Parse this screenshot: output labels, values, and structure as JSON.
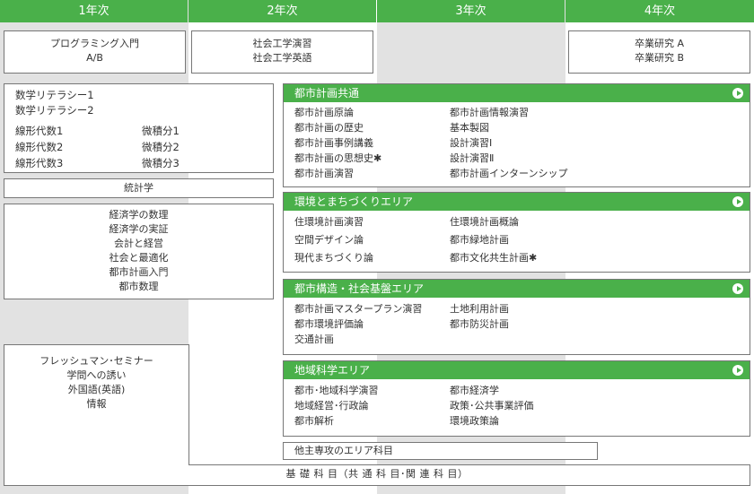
{
  "headers": [
    "1年次",
    "2年次",
    "3年次",
    "4年次"
  ],
  "year1_top": [
    "プログラミング入門",
    "A/B"
  ],
  "year2_top": [
    "社会工学演習",
    "社会工学英語"
  ],
  "year4_top": [
    "卒業研究 A",
    "卒業研究 B"
  ],
  "math": {
    "top": [
      "数学リテラシー1",
      "数学リテラシー2"
    ],
    "left": [
      "線形代数1",
      "線形代数2",
      "線形代数3"
    ],
    "right": [
      "微積分1",
      "微積分2",
      "微積分3"
    ]
  },
  "statistics": "統計学",
  "econ": [
    "経済学の数理",
    "経済学の実証",
    "会計と経営",
    "社会と最適化",
    "都市計画入門",
    "都市数理"
  ],
  "freshman": [
    "フレッシュマン･セミナー",
    "学問への誘い",
    "外国語(英語)",
    "情報"
  ],
  "groups": [
    {
      "title": "都市計画共通",
      "left": [
        "都市計画原論",
        "都市計画の歴史",
        "都市計画事例講義",
        "都市計画の思想史✱",
        "都市計画演習"
      ],
      "right": [
        "都市計画情報演習",
        "基本製図",
        "設計演習Ⅰ",
        "設計演習Ⅱ",
        "都市計画インターンシップ"
      ]
    },
    {
      "title": "環境とまちづくりエリア",
      "left": [
        "住環境計画演習",
        "空間デザイン論",
        "現代まちづくり論"
      ],
      "right": [
        "住環境計画概論",
        "都市緑地計画",
        "都市文化共生計画✱"
      ]
    },
    {
      "title": "都市構造・社会基盤エリア",
      "left": [
        "都市計画マスタープラン演習",
        "都市環境評価論",
        "交通計画"
      ],
      "right": [
        "土地利用計画",
        "都市防災計画"
      ]
    },
    {
      "title": "地域科学エリア",
      "left": [
        "都市･地域科学演習",
        "地域経営･行政論",
        "都市解析"
      ],
      "right": [
        "都市経済学",
        "政策･公共事業評価",
        "環境政策論"
      ]
    }
  ],
  "other_major": "他主専攻のエリア科目",
  "foundation": "基 礎 科 目（共 通 科 目･関 連 科 目）",
  "colors": {
    "accent_green": "#4ab04a",
    "column_gray": "#e2e2e2",
    "border": "#777777"
  }
}
